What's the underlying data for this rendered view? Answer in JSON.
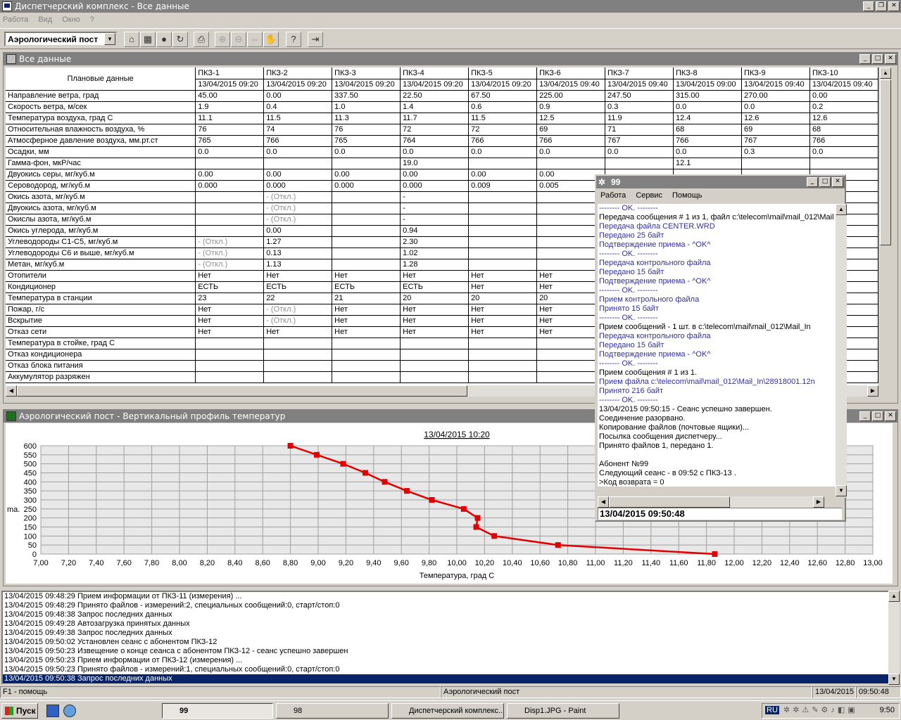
{
  "app": {
    "title": "Диспетчерский комплекс - Все данные",
    "icon": "app-icon"
  },
  "menu": [
    "Работа",
    "Вид",
    "Окно",
    "?"
  ],
  "toolbar": {
    "post_select": "Аэрологический пост"
  },
  "data_window": {
    "title": "Все данные",
    "row_header_label": "Плановые данные",
    "columns": [
      {
        "name": "ПКЗ-1",
        "time": "13/04/2015 09:20"
      },
      {
        "name": "ПКЗ-2",
        "time": "13/04/2015 09:20"
      },
      {
        "name": "ПКЗ-3",
        "time": "13/04/2015 09:20"
      },
      {
        "name": "ПКЗ-4",
        "time": "13/04/2015 09:20"
      },
      {
        "name": "ПКЗ-5",
        "time": "13/04/2015 09:20"
      },
      {
        "name": "ПКЗ-6",
        "time": "13/04/2015 09:40"
      },
      {
        "name": "ПКЗ-7",
        "time": "13/04/2015 09:40"
      },
      {
        "name": "ПКЗ-8",
        "time": "13/04/2015 09:00"
      },
      {
        "name": "ПКЗ-9",
        "time": "13/04/2015 09:40"
      },
      {
        "name": "ПКЗ-10",
        "time": "13/04/2015 09:40"
      }
    ],
    "rows": [
      {
        "label": "Направление ветра, град",
        "cells": [
          "45.00",
          "0.00",
          "337.50",
          "22.50",
          "67.50",
          "225.00",
          "247.50",
          "315.00",
          "270.00",
          "0.00"
        ]
      },
      {
        "label": "Скорость ветра, м/сек",
        "cells": [
          "1.9",
          "0.4",
          "1.0",
          "1.4",
          "0.6",
          "0.9",
          "0.3",
          "0.0",
          "0.0",
          "0.2"
        ]
      },
      {
        "label": "Температура воздуха, град С",
        "cells": [
          "11.1",
          "11.5",
          "11.3",
          "11.7",
          "11.5",
          "12.5",
          "11.9",
          "12.4",
          "12.6",
          "12.6"
        ]
      },
      {
        "label": "Относительная влажность воздуха, %",
        "cells": [
          "76",
          "74",
          "76",
          "72",
          "72",
          "69",
          "71",
          "68",
          "69",
          "68"
        ]
      },
      {
        "label": "Атмосферное давление воздуха, мм.рт.ст",
        "cells": [
          "765",
          "766",
          "765",
          "764",
          "766",
          "766",
          "767",
          "766",
          "767",
          "766"
        ]
      },
      {
        "label": "Осадки, мм",
        "cells": [
          "0.0",
          "0.0",
          "0.0",
          "0.0",
          "0.0",
          "0.0",
          "0.0",
          "0.0",
          "0.3",
          "0.0"
        ]
      },
      {
        "label": "Гамма-фон, мкР/час",
        "cells": [
          "",
          "",
          "",
          "19.0",
          "",
          "",
          "",
          "12.1",
          "",
          ""
        ]
      },
      {
        "label": "Двуокись серы, мг/куб.м",
        "cells": [
          "0.00",
          "0.00",
          "0.00",
          "0.00",
          "0.00",
          "0.00",
          "",
          "",
          "",
          ""
        ]
      },
      {
        "label": "Сероводород, мг/куб.м",
        "cells": [
          "0.000",
          "0.000",
          "0.000",
          "0.000",
          "0.009",
          "0.005",
          "",
          "",
          "",
          ""
        ]
      },
      {
        "label": "Окись азота, мг/куб.м",
        "cells": [
          "",
          "- (Откл.)",
          "",
          "-",
          "",
          "",
          "",
          "",
          "",
          ""
        ]
      },
      {
        "label": "Двуокись азота, мг/куб.м",
        "cells": [
          "",
          "- (Откл.)",
          "",
          "-",
          "",
          "",
          "",
          "",
          "",
          ""
        ]
      },
      {
        "label": "Окислы азота, мг/куб.м",
        "cells": [
          "",
          "- (Откл.)",
          "",
          "-",
          "",
          "",
          "",
          "",
          "",
          ""
        ]
      },
      {
        "label": "Окись углерода, мг/куб.м",
        "cells": [
          "",
          "0.00",
          "",
          "0.94",
          "",
          "",
          "",
          "",
          "",
          ""
        ]
      },
      {
        "label": "Углеводороды С1-С5, мг/куб.м",
        "cells": [
          "- (Откл.)",
          "1.27",
          "",
          "2.30",
          "",
          "",
          "",
          "",
          "",
          ""
        ]
      },
      {
        "label": "Углеводороды С6 и выше, мг/куб.м",
        "cells": [
          "- (Откл.)",
          "0.13",
          "",
          "1.02",
          "",
          "",
          "",
          "",
          "",
          ""
        ]
      },
      {
        "label": "Метан, мг/куб.м",
        "cells": [
          "- (Откл.)",
          "1.13",
          "",
          "1.28",
          "",
          "",
          "",
          "",
          "",
          ""
        ]
      },
      {
        "label": "Отопители",
        "cells": [
          "Нет",
          "Нет",
          "Нет",
          "Нет",
          "Нет",
          "Нет",
          "",
          "",
          "",
          ""
        ]
      },
      {
        "label": "Кондиционер",
        "cells": [
          "ЕСТЬ",
          "ЕСТЬ",
          "ЕСТЬ",
          "ЕСТЬ",
          "Нет",
          "Нет",
          "",
          "",
          "",
          ""
        ]
      },
      {
        "label": "Температура в станции",
        "cells": [
          "23",
          "22",
          "21",
          "20",
          "20",
          "20",
          "",
          "",
          "",
          ""
        ]
      },
      {
        "label": "Пожар, г/с",
        "cells": [
          "Нет",
          "- (Откл.)",
          "Нет",
          "Нет",
          "Нет",
          "Нет",
          "",
          "",
          "",
          ""
        ]
      },
      {
        "label": "Вскрытие",
        "cells": [
          "Нет",
          "- (Откл.)",
          "Нет",
          "Нет",
          "Нет",
          "Нет",
          "",
          "",
          "",
          ""
        ]
      },
      {
        "label": "Отказ сети",
        "cells": [
          "Нет",
          "Нет",
          "Нет",
          "Нет",
          "Нет",
          "Нет",
          "",
          "",
          "",
          ""
        ]
      },
      {
        "label": "Температура в стойке, град С",
        "cells": [
          "",
          "",
          "",
          "",
          "",
          "",
          "",
          "",
          "",
          ""
        ]
      },
      {
        "label": "Отказ кондиционера",
        "cells": [
          "",
          "",
          "",
          "",
          "",
          "",
          "",
          "",
          "",
          ""
        ]
      },
      {
        "label": "Отказ блока питания",
        "cells": [
          "",
          "",
          "",
          "",
          "",
          "",
          "",
          "",
          "",
          ""
        ]
      },
      {
        "label": "Аккумулятор разряжен",
        "cells": [
          "",
          "",
          "",
          "",
          "",
          "",
          "",
          "",
          "",
          ""
        ]
      }
    ]
  },
  "chart_window": {
    "title": "Аэрологический пост - Вертикальный профиль температур"
  },
  "chart_data": {
    "type": "line",
    "title": "13/04/2015 10:20",
    "xlabel": "Температура, град С",
    "ylabel": "mа.",
    "xlim": [
      7.0,
      13.0
    ],
    "ylim": [
      0,
      600
    ],
    "xticks": [
      "7,00",
      "7,20",
      "7,40",
      "7,60",
      "7,80",
      "8,00",
      "8,20",
      "8,40",
      "8,60",
      "8,80",
      "9,00",
      "9,20",
      "9,40",
      "9,60",
      "9,80",
      "10,00",
      "10,20",
      "10,40",
      "10,60",
      "10,80",
      "11,00",
      "11,20",
      "11,40",
      "11,60",
      "11,80",
      "12,00",
      "12,20",
      "12,40",
      "12,60",
      "12,80",
      "13,00"
    ],
    "yticks": [
      "0",
      "50",
      "100",
      "150",
      "200",
      "250",
      "300",
      "350",
      "400",
      "450",
      "500",
      "550",
      "600"
    ],
    "grid": true,
    "color": "#e00000",
    "points": [
      [
        8.8,
        600
      ],
      [
        8.99,
        550
      ],
      [
        9.18,
        500
      ],
      [
        9.34,
        450
      ],
      [
        9.48,
        400
      ],
      [
        9.64,
        350
      ],
      [
        9.82,
        300
      ],
      [
        10.05,
        250
      ],
      [
        10.15,
        200
      ],
      [
        10.14,
        150
      ],
      [
        10.27,
        100
      ],
      [
        10.73,
        50
      ],
      [
        11.86,
        0
      ]
    ]
  },
  "log": [
    "13/04/2015 09:48:29 Прием информации от ПКЗ-11 (измерения) ...",
    "13/04/2015 09:48:29 Принято файлов - измерений:2, специальных сообщений:0, старт/стоп:0",
    "13/04/2015 09:48:38 Запрос последних данных",
    "13/04/2015 09:49:28 Автозагрузка принятых данных",
    "13/04/2015 09:49:38 Запрос последних данных",
    "13/04/2015 09:50:02 Установлен сеанс с абонентом ПКЗ-12",
    "13/04/2015 09:50:23 Извещение о конце сеанса с абонентом ПКЗ-12 - сеанс успешно завершен",
    "13/04/2015 09:50:23 Прием информации от ПКЗ-12 (измерения) ...",
    "13/04/2015 09:50:23 Принято файлов - измерений:1, специальных сообщений:0, старт/стоп:0",
    "13/04/2015 09:50:38 Запрос последних данных"
  ],
  "status": {
    "help": "F1 - помощь",
    "post": "Аэрологический пост",
    "date": "13/04/2015",
    "time": "09:50:48"
  },
  "comm_window": {
    "title": "99",
    "menu": [
      "Работа",
      "Сервис",
      "Помощь"
    ],
    "lines": [
      {
        "t": "--------          OK.          --------",
        "c": "b"
      },
      {
        "t": "Передача сообщения # 1 из 1, файл c:\\telecom\\mail\\mail_012\\Mail",
        "c": ""
      },
      {
        "t": "Передача файла CENTER.WRD",
        "c": "b"
      },
      {
        "t": "Передано 25 байт",
        "c": "b"
      },
      {
        "t": "Подтверждение приема - ^OK^",
        "c": "b"
      },
      {
        "t": "--------          OK.          --------",
        "c": "b"
      },
      {
        "t": "Передача контрольного файла",
        "c": "b"
      },
      {
        "t": "Передано 15 байт",
        "c": "b"
      },
      {
        "t": "Подтверждение приема - ^OK^",
        "c": "b"
      },
      {
        "t": "--------          OK.          --------",
        "c": "b"
      },
      {
        "t": "Прием контрольного файла",
        "c": "b"
      },
      {
        "t": "Принято 15 байт",
        "c": "b"
      },
      {
        "t": "--------          OK.          --------",
        "c": "b"
      },
      {
        "t": "Прием сообщений - 1 шт. в c:\\telecom\\mail\\mail_012\\Mail_In",
        "c": ""
      },
      {
        "t": "Передача контрольного файла",
        "c": "b"
      },
      {
        "t": "Передано 15 байт",
        "c": "b"
      },
      {
        "t": "Подтверждение приема - ^OK^",
        "c": "b"
      },
      {
        "t": "--------          OK.          --------",
        "c": "b"
      },
      {
        "t": "Прием сообщения # 1 из 1.",
        "c": ""
      },
      {
        "t": "Прием файла c:\\telecom\\mail\\mail_012\\Mail_In\\28918001.12n",
        "c": "b"
      },
      {
        "t": "Принято 216 байт",
        "c": "b"
      },
      {
        "t": "--------          OK.          --------",
        "c": "b"
      },
      {
        "t": "13/04/2015 09:50:15 - Сеанс успешно завершен.",
        "c": ""
      },
      {
        "t": "Соединение разорвано.",
        "c": ""
      },
      {
        "t": "Копирование файлов (почтовые ящики)...",
        "c": ""
      },
      {
        "t": "Посылка сообщения диспетчеру...",
        "c": ""
      },
      {
        "t": "Принято файлов 1, передано 1.",
        "c": ""
      },
      {
        "t": "",
        "c": ""
      },
      {
        "t": "Абонент №99",
        "c": ""
      },
      {
        "t": "Следующий сеанс - в 09:52 с ПКЗ-13 .",
        "c": ""
      },
      {
        "t": ">Код возврата = 0",
        "c": ""
      }
    ],
    "timestamp": "13/04/2015 09:50:48"
  },
  "taskbar": {
    "start": "Пуск",
    "tasks": [
      "99",
      "98",
      "Диспетчерский комплекс...",
      "Disp1.JPG - Paint"
    ],
    "lang": "RU",
    "clock": "9:50"
  }
}
